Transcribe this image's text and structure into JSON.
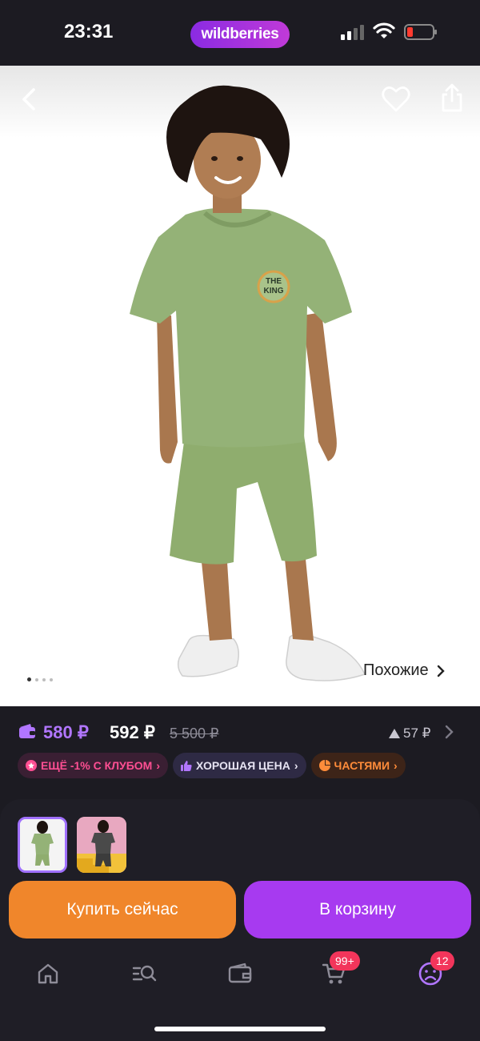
{
  "status_bar": {
    "time": "23:31",
    "brand": "wildberries"
  },
  "gallery": {
    "similar_label": "Похожие",
    "dot_count": 4,
    "active_dot": 0
  },
  "price": {
    "wallet_price": "580 ₽",
    "current_price": "592 ₽",
    "old_price": "5 500 ₽",
    "change": "57 ₽"
  },
  "badges": {
    "club": "ЕЩЁ -1% С КЛУБОМ",
    "good_price": "ХОРОШАЯ ЦЕНА",
    "installments": "ЧАСТЯМИ"
  },
  "actions": {
    "buy_now": "Купить сейчас",
    "add_to_cart": "В корзину"
  },
  "tabbar": {
    "cart_badge": "99+",
    "profile_badge": "12"
  },
  "colors": {
    "accent_purple": "#a73af0",
    "accent_orange": "#f0862b",
    "wallet_price": "#b176ff",
    "badge_red": "#f2355b"
  },
  "icons": [
    "back-icon",
    "heart-icon",
    "share-icon",
    "wallet-icon",
    "home-icon",
    "search-icon",
    "wallet-tab-icon",
    "cart-icon",
    "profile-icon"
  ]
}
